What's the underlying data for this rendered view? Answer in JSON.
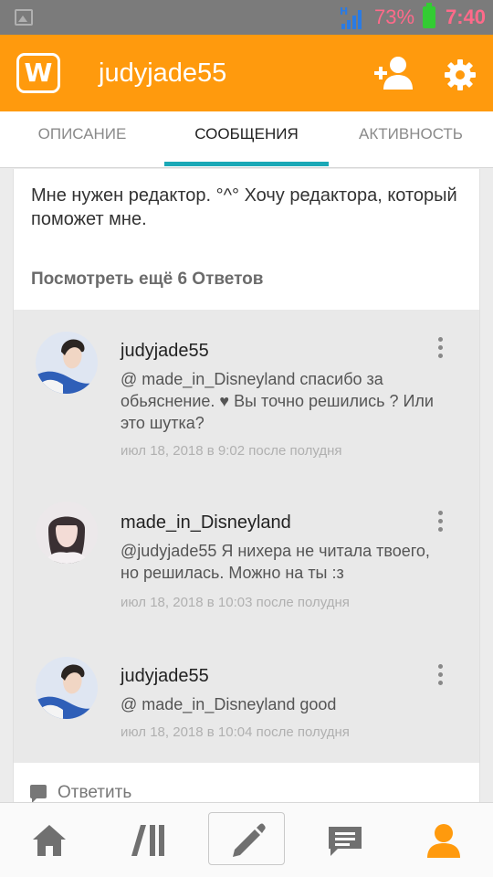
{
  "status_bar": {
    "battery_percent": "73%",
    "time": "7:40",
    "network": "H",
    "icons": [
      "image-icon",
      "signal-icon",
      "battery-icon"
    ]
  },
  "app_bar": {
    "logo_letter": "W",
    "title": "judyjade55",
    "icons": [
      "add-user-icon",
      "gear-icon"
    ],
    "color": "#ff9a0d"
  },
  "tabs": [
    {
      "label": "ОПИСАНИЕ"
    },
    {
      "label": "СООБЩЕНИЯ"
    },
    {
      "label": "АКТИВНОСТЬ"
    }
  ],
  "post": {
    "text": "Мне нужен редактор. °^° Хочу редактора, который поможет мне.",
    "more_replies_label": "Посмотреть ещё 6 Ответов"
  },
  "replies": [
    {
      "username": "judyjade55",
      "text": "@ made_in_Disneyland  спасибо за обьяснение. ♥ Вы точно решились ? Или это шутка?",
      "timestamp": "июл 18, 2018 в 9:02 после полудня"
    },
    {
      "username": "made_in_Disneyland",
      "text": "@judyjade55  Я нихера не читала твоего, но решилась. Можно на ты :з",
      "timestamp": "июл 18, 2018 в 10:03 после полудня"
    },
    {
      "username": "judyjade55",
      "text": "@ made_in_Disneyland  good",
      "timestamp": "июл 18, 2018 в 10:04 после полудня"
    }
  ],
  "reply_action": {
    "label": "Ответить"
  },
  "bottom_nav": {
    "items": [
      "home-icon",
      "library-icon",
      "write-icon",
      "messages-icon",
      "profile-icon"
    ],
    "active_color": "#ff9a0d"
  }
}
